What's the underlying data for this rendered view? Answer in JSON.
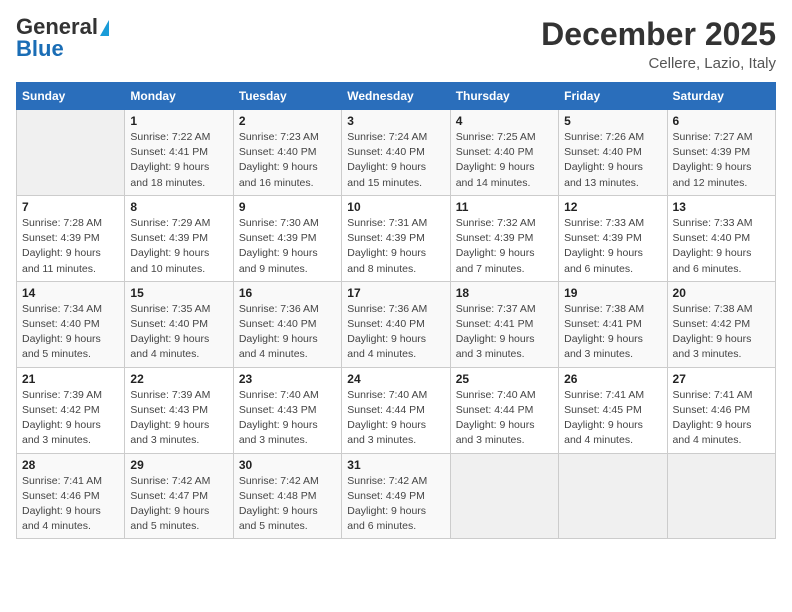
{
  "header": {
    "logo_line1": "General",
    "logo_line2": "Blue",
    "month": "December 2025",
    "location": "Cellere, Lazio, Italy"
  },
  "days_of_week": [
    "Sunday",
    "Monday",
    "Tuesday",
    "Wednesday",
    "Thursday",
    "Friday",
    "Saturday"
  ],
  "weeks": [
    [
      {
        "day": "",
        "detail": ""
      },
      {
        "day": "1",
        "detail": "Sunrise: 7:22 AM\nSunset: 4:41 PM\nDaylight: 9 hours\nand 18 minutes."
      },
      {
        "day": "2",
        "detail": "Sunrise: 7:23 AM\nSunset: 4:40 PM\nDaylight: 9 hours\nand 16 minutes."
      },
      {
        "day": "3",
        "detail": "Sunrise: 7:24 AM\nSunset: 4:40 PM\nDaylight: 9 hours\nand 15 minutes."
      },
      {
        "day": "4",
        "detail": "Sunrise: 7:25 AM\nSunset: 4:40 PM\nDaylight: 9 hours\nand 14 minutes."
      },
      {
        "day": "5",
        "detail": "Sunrise: 7:26 AM\nSunset: 4:40 PM\nDaylight: 9 hours\nand 13 minutes."
      },
      {
        "day": "6",
        "detail": "Sunrise: 7:27 AM\nSunset: 4:39 PM\nDaylight: 9 hours\nand 12 minutes."
      }
    ],
    [
      {
        "day": "7",
        "detail": "Sunrise: 7:28 AM\nSunset: 4:39 PM\nDaylight: 9 hours\nand 11 minutes."
      },
      {
        "day": "8",
        "detail": "Sunrise: 7:29 AM\nSunset: 4:39 PM\nDaylight: 9 hours\nand 10 minutes."
      },
      {
        "day": "9",
        "detail": "Sunrise: 7:30 AM\nSunset: 4:39 PM\nDaylight: 9 hours\nand 9 minutes."
      },
      {
        "day": "10",
        "detail": "Sunrise: 7:31 AM\nSunset: 4:39 PM\nDaylight: 9 hours\nand 8 minutes."
      },
      {
        "day": "11",
        "detail": "Sunrise: 7:32 AM\nSunset: 4:39 PM\nDaylight: 9 hours\nand 7 minutes."
      },
      {
        "day": "12",
        "detail": "Sunrise: 7:33 AM\nSunset: 4:39 PM\nDaylight: 9 hours\nand 6 minutes."
      },
      {
        "day": "13",
        "detail": "Sunrise: 7:33 AM\nSunset: 4:40 PM\nDaylight: 9 hours\nand 6 minutes."
      }
    ],
    [
      {
        "day": "14",
        "detail": "Sunrise: 7:34 AM\nSunset: 4:40 PM\nDaylight: 9 hours\nand 5 minutes."
      },
      {
        "day": "15",
        "detail": "Sunrise: 7:35 AM\nSunset: 4:40 PM\nDaylight: 9 hours\nand 4 minutes."
      },
      {
        "day": "16",
        "detail": "Sunrise: 7:36 AM\nSunset: 4:40 PM\nDaylight: 9 hours\nand 4 minutes."
      },
      {
        "day": "17",
        "detail": "Sunrise: 7:36 AM\nSunset: 4:40 PM\nDaylight: 9 hours\nand 4 minutes."
      },
      {
        "day": "18",
        "detail": "Sunrise: 7:37 AM\nSunset: 4:41 PM\nDaylight: 9 hours\nand 3 minutes."
      },
      {
        "day": "19",
        "detail": "Sunrise: 7:38 AM\nSunset: 4:41 PM\nDaylight: 9 hours\nand 3 minutes."
      },
      {
        "day": "20",
        "detail": "Sunrise: 7:38 AM\nSunset: 4:42 PM\nDaylight: 9 hours\nand 3 minutes."
      }
    ],
    [
      {
        "day": "21",
        "detail": "Sunrise: 7:39 AM\nSunset: 4:42 PM\nDaylight: 9 hours\nand 3 minutes."
      },
      {
        "day": "22",
        "detail": "Sunrise: 7:39 AM\nSunset: 4:43 PM\nDaylight: 9 hours\nand 3 minutes."
      },
      {
        "day": "23",
        "detail": "Sunrise: 7:40 AM\nSunset: 4:43 PM\nDaylight: 9 hours\nand 3 minutes."
      },
      {
        "day": "24",
        "detail": "Sunrise: 7:40 AM\nSunset: 4:44 PM\nDaylight: 9 hours\nand 3 minutes."
      },
      {
        "day": "25",
        "detail": "Sunrise: 7:40 AM\nSunset: 4:44 PM\nDaylight: 9 hours\nand 3 minutes."
      },
      {
        "day": "26",
        "detail": "Sunrise: 7:41 AM\nSunset: 4:45 PM\nDaylight: 9 hours\nand 4 minutes."
      },
      {
        "day": "27",
        "detail": "Sunrise: 7:41 AM\nSunset: 4:46 PM\nDaylight: 9 hours\nand 4 minutes."
      }
    ],
    [
      {
        "day": "28",
        "detail": "Sunrise: 7:41 AM\nSunset: 4:46 PM\nDaylight: 9 hours\nand 4 minutes."
      },
      {
        "day": "29",
        "detail": "Sunrise: 7:42 AM\nSunset: 4:47 PM\nDaylight: 9 hours\nand 5 minutes."
      },
      {
        "day": "30",
        "detail": "Sunrise: 7:42 AM\nSunset: 4:48 PM\nDaylight: 9 hours\nand 5 minutes."
      },
      {
        "day": "31",
        "detail": "Sunrise: 7:42 AM\nSunset: 4:49 PM\nDaylight: 9 hours\nand 6 minutes."
      },
      {
        "day": "",
        "detail": ""
      },
      {
        "day": "",
        "detail": ""
      },
      {
        "day": "",
        "detail": ""
      }
    ]
  ]
}
